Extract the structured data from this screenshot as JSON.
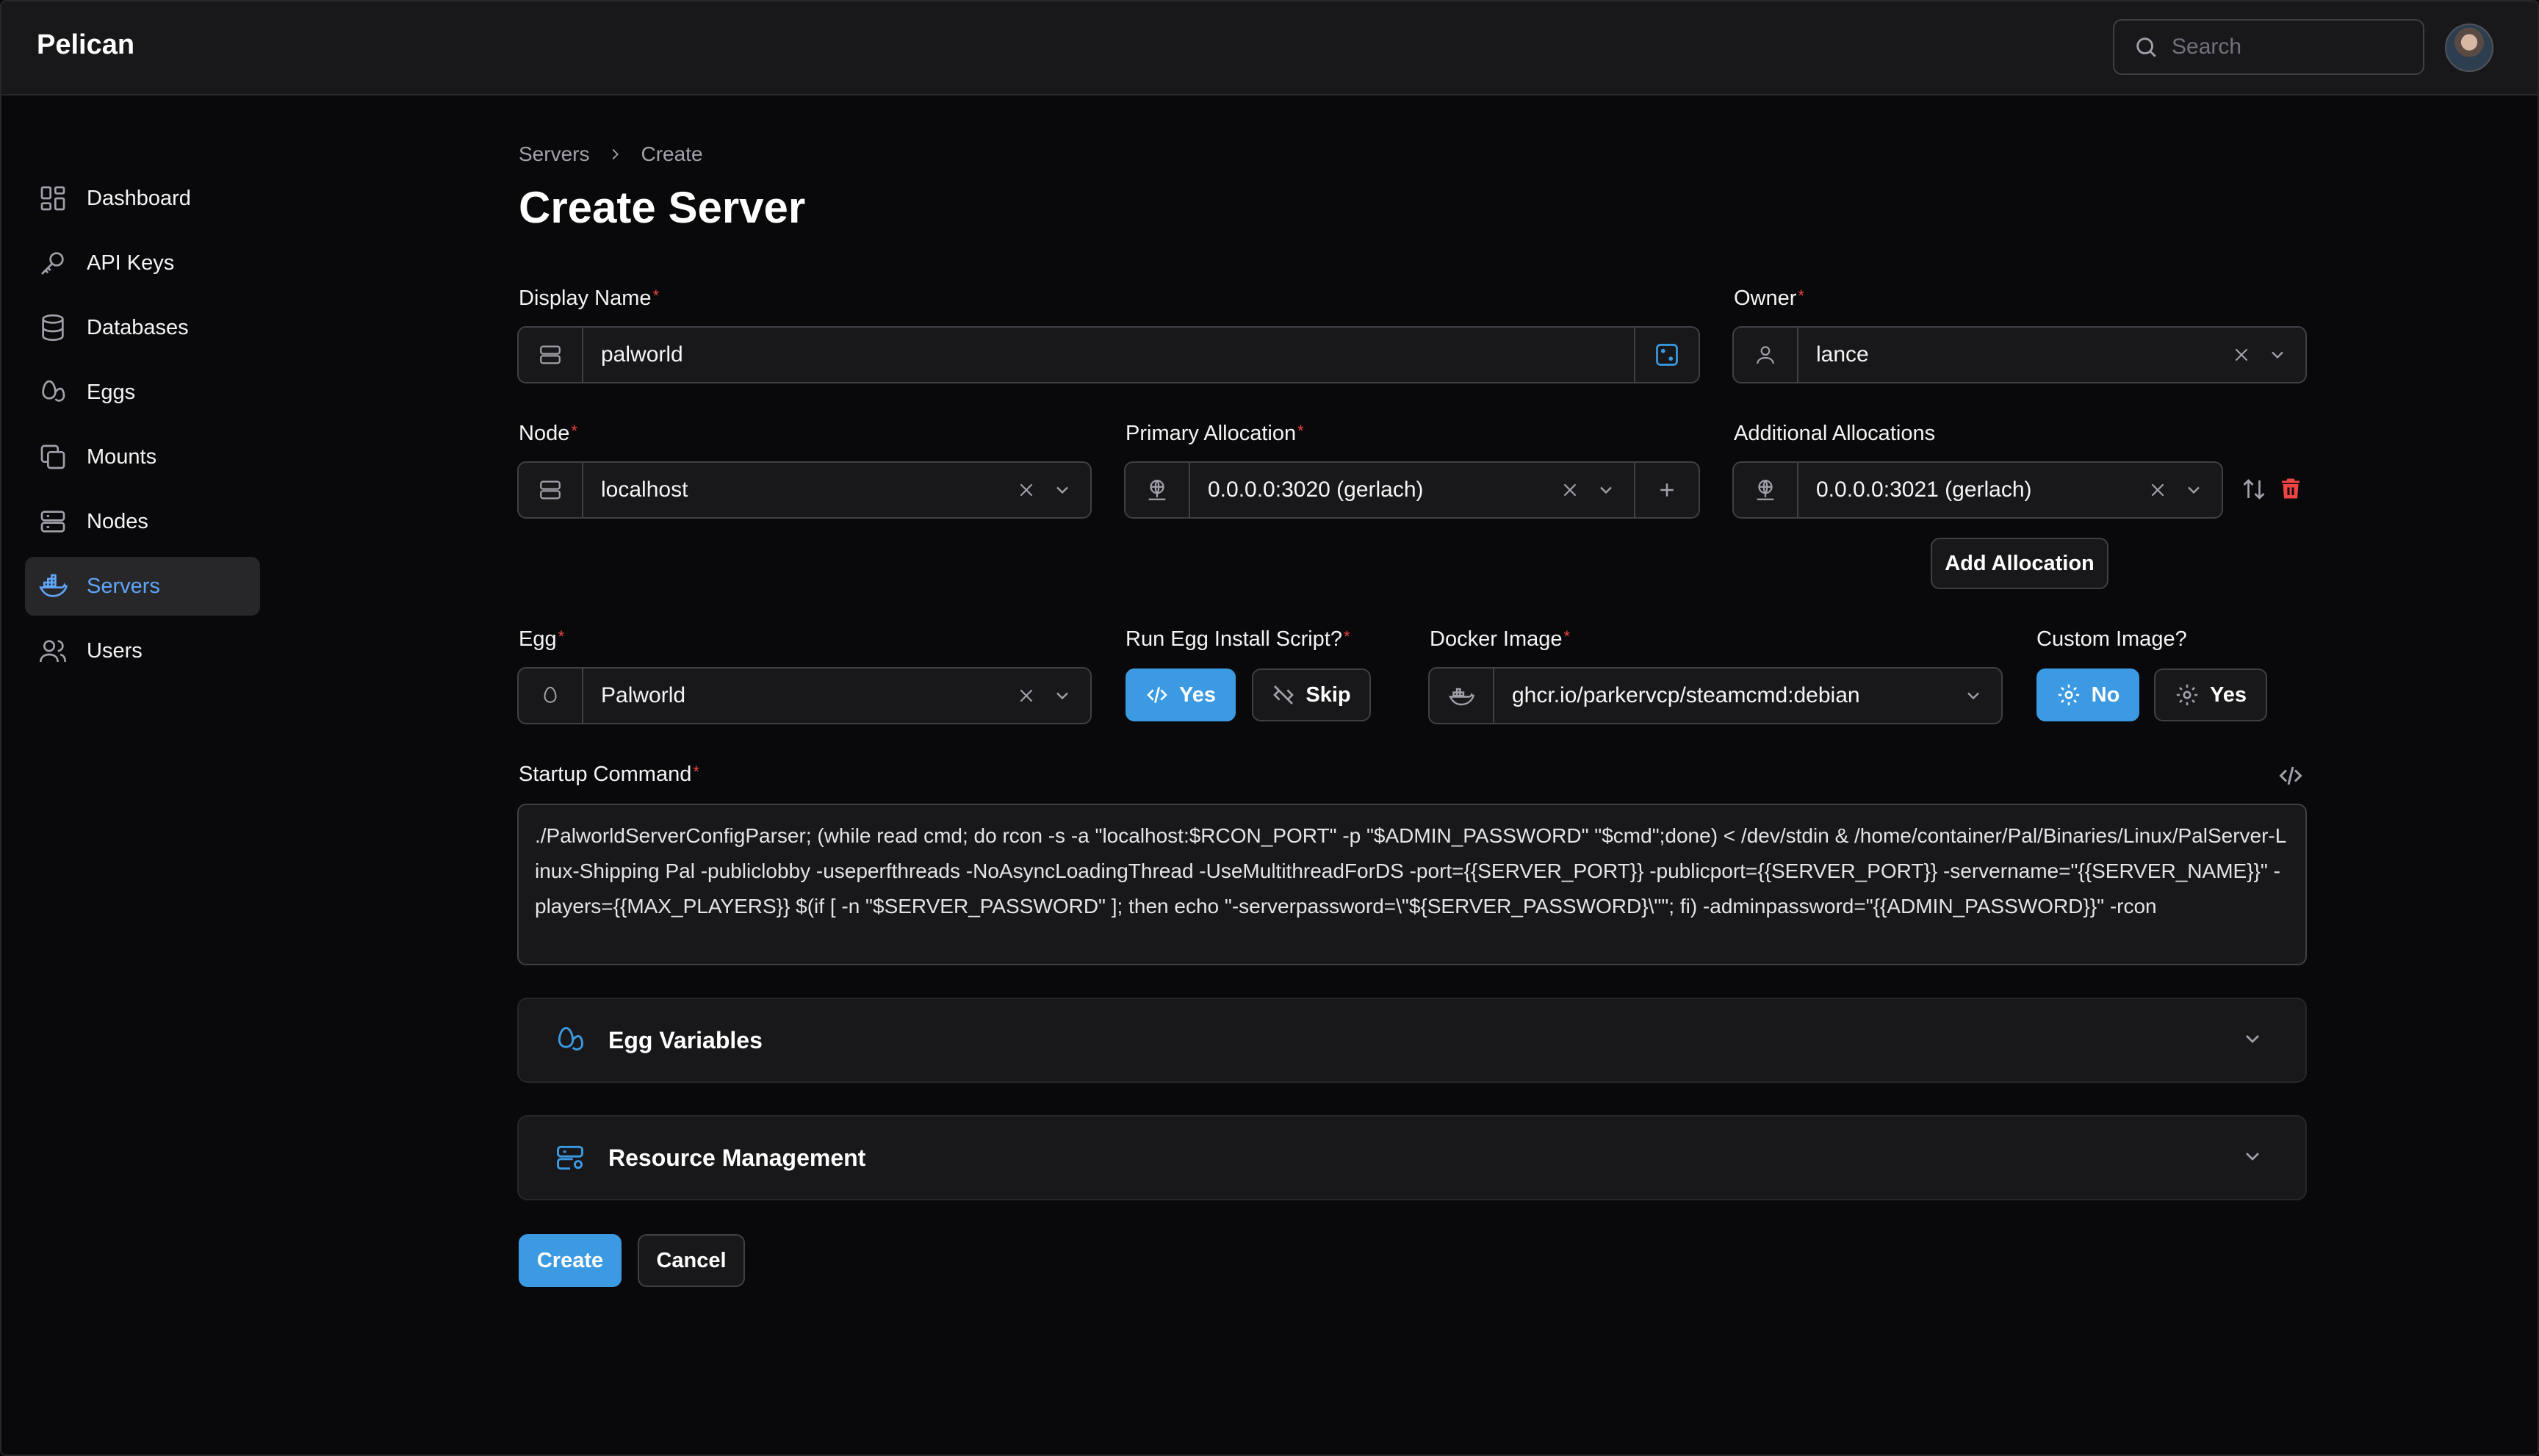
{
  "app": {
    "name": "Pelican"
  },
  "search": {
    "placeholder": "Search"
  },
  "sidebar": {
    "items": [
      {
        "label": "Dashboard",
        "icon": "dashboard-icon"
      },
      {
        "label": "API Keys",
        "icon": "key-icon"
      },
      {
        "label": "Databases",
        "icon": "database-icon"
      },
      {
        "label": "Eggs",
        "icon": "eggs-icon"
      },
      {
        "label": "Mounts",
        "icon": "mounts-icon"
      },
      {
        "label": "Nodes",
        "icon": "server-icon"
      },
      {
        "label": "Servers",
        "icon": "docker-icon",
        "active": true
      },
      {
        "label": "Users",
        "icon": "users-icon"
      }
    ]
  },
  "breadcrumb": {
    "items": [
      "Servers",
      "Create"
    ]
  },
  "page": {
    "title": "Create Server"
  },
  "form": {
    "display_name": {
      "label": "Display Name",
      "value": "palworld"
    },
    "owner": {
      "label": "Owner",
      "value": "lance"
    },
    "node": {
      "label": "Node",
      "value": "localhost"
    },
    "primary_allocation": {
      "label": "Primary Allocation",
      "value": "0.0.0.0:3020 (gerlach)"
    },
    "additional_allocations": {
      "label": "Additional Allocations",
      "value": "0.0.0.0:3021 (gerlach)",
      "add_label": "Add Allocation"
    },
    "egg": {
      "label": "Egg",
      "value": "Palworld"
    },
    "run_install": {
      "label": "Run Egg Install Script?",
      "yes": "Yes",
      "skip": "Skip",
      "selected": "Yes"
    },
    "docker_image": {
      "label": "Docker Image",
      "value": "ghcr.io/parkervcp/steamcmd:debian"
    },
    "custom_image": {
      "label": "Custom Image?",
      "no": "No",
      "yes": "Yes",
      "selected": "No"
    },
    "startup": {
      "label": "Startup Command",
      "value": "./PalworldServerConfigParser; (while read cmd; do rcon -s -a \"localhost:$RCON_PORT\" -p \"$ADMIN_PASSWORD\" \"$cmd\";done) < /dev/stdin & /home/container/Pal/Binaries/Linux/PalServer-Linux-Shipping Pal -publiclobby -useperfthreads -NoAsyncLoadingThread -UseMultithreadForDS -port={{SERVER_PORT}} -publicport={{SERVER_PORT}} -servername=\"{{SERVER_NAME}}\" -players={{MAX_PLAYERS}} $(if [ -n \"$SERVER_PASSWORD\" ]; then echo \"-serverpassword=\\\"${SERVER_PASSWORD}\\\"\"; fi) -adminpassword=\"{{ADMIN_PASSWORD}}\" -rcon"
    }
  },
  "sections": {
    "egg_variables": "Egg Variables",
    "resource_management": "Resource Management"
  },
  "actions": {
    "create": "Create",
    "cancel": "Cancel"
  },
  "colors": {
    "accent": "#3b9ae1",
    "danger": "#ef4444",
    "background": "#09090b",
    "surface": "#18181b"
  }
}
